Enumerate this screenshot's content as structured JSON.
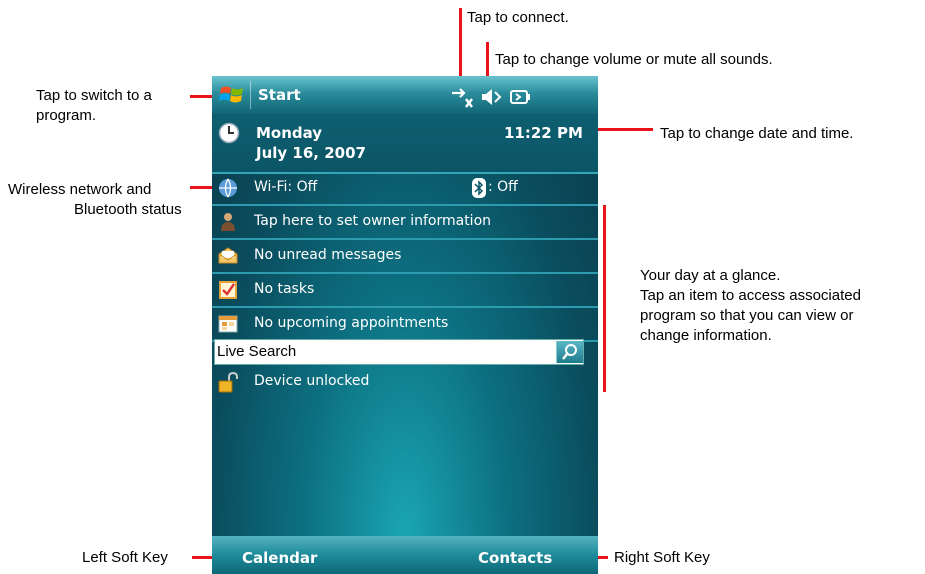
{
  "annotations": {
    "switch_program": "Tap to switch to a\nprogram.",
    "connect": "Tap to connect.",
    "volume": "Tap to change volume or mute all sounds.",
    "date_time": "Tap to change date and time.",
    "wireless_line1": "Wireless network and",
    "wireless_line2": "Bluetooth status",
    "glance_line1": "Your day at a glance.",
    "glance_line2": "Tap an item to access associated",
    "glance_line3": "program so that you can view or",
    "glance_line4": "change information.",
    "left_soft_key": "Left Soft Key",
    "right_soft_key": "Right Soft Key"
  },
  "titlebar": {
    "start_label": "Start"
  },
  "today": {
    "day": "Monday",
    "date": "July 16, 2007",
    "time": "11:22 PM",
    "wifi": "Wi-Fi: Off",
    "bluetooth": ": Off",
    "owner": "Tap here to set owner information",
    "messages": "No unread messages",
    "tasks": "No tasks",
    "appointments": "No upcoming appointments",
    "search_placeholder": "Live Search",
    "lock_status": "Device unlocked"
  },
  "softkeys": {
    "left": "Calendar",
    "right": "Contacts"
  },
  "colors": {
    "annotation_line": "#e8141a",
    "screen_bg": "#0c6f80"
  }
}
